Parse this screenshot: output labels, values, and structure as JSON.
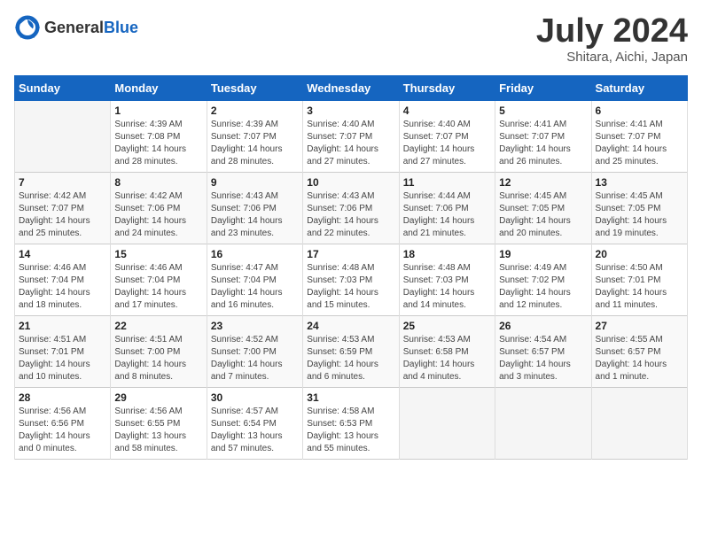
{
  "header": {
    "logo_general": "General",
    "logo_blue": "Blue",
    "month": "July 2024",
    "location": "Shitara, Aichi, Japan"
  },
  "days_of_week": [
    "Sunday",
    "Monday",
    "Tuesday",
    "Wednesday",
    "Thursday",
    "Friday",
    "Saturday"
  ],
  "weeks": [
    [
      {
        "day": "",
        "info": ""
      },
      {
        "day": "1",
        "info": "Sunrise: 4:39 AM\nSunset: 7:08 PM\nDaylight: 14 hours\nand 28 minutes."
      },
      {
        "day": "2",
        "info": "Sunrise: 4:39 AM\nSunset: 7:07 PM\nDaylight: 14 hours\nand 28 minutes."
      },
      {
        "day": "3",
        "info": "Sunrise: 4:40 AM\nSunset: 7:07 PM\nDaylight: 14 hours\nand 27 minutes."
      },
      {
        "day": "4",
        "info": "Sunrise: 4:40 AM\nSunset: 7:07 PM\nDaylight: 14 hours\nand 27 minutes."
      },
      {
        "day": "5",
        "info": "Sunrise: 4:41 AM\nSunset: 7:07 PM\nDaylight: 14 hours\nand 26 minutes."
      },
      {
        "day": "6",
        "info": "Sunrise: 4:41 AM\nSunset: 7:07 PM\nDaylight: 14 hours\nand 25 minutes."
      }
    ],
    [
      {
        "day": "7",
        "info": "Sunrise: 4:42 AM\nSunset: 7:07 PM\nDaylight: 14 hours\nand 25 minutes."
      },
      {
        "day": "8",
        "info": "Sunrise: 4:42 AM\nSunset: 7:06 PM\nDaylight: 14 hours\nand 24 minutes."
      },
      {
        "day": "9",
        "info": "Sunrise: 4:43 AM\nSunset: 7:06 PM\nDaylight: 14 hours\nand 23 minutes."
      },
      {
        "day": "10",
        "info": "Sunrise: 4:43 AM\nSunset: 7:06 PM\nDaylight: 14 hours\nand 22 minutes."
      },
      {
        "day": "11",
        "info": "Sunrise: 4:44 AM\nSunset: 7:06 PM\nDaylight: 14 hours\nand 21 minutes."
      },
      {
        "day": "12",
        "info": "Sunrise: 4:45 AM\nSunset: 7:05 PM\nDaylight: 14 hours\nand 20 minutes."
      },
      {
        "day": "13",
        "info": "Sunrise: 4:45 AM\nSunset: 7:05 PM\nDaylight: 14 hours\nand 19 minutes."
      }
    ],
    [
      {
        "day": "14",
        "info": "Sunrise: 4:46 AM\nSunset: 7:04 PM\nDaylight: 14 hours\nand 18 minutes."
      },
      {
        "day": "15",
        "info": "Sunrise: 4:46 AM\nSunset: 7:04 PM\nDaylight: 14 hours\nand 17 minutes."
      },
      {
        "day": "16",
        "info": "Sunrise: 4:47 AM\nSunset: 7:04 PM\nDaylight: 14 hours\nand 16 minutes."
      },
      {
        "day": "17",
        "info": "Sunrise: 4:48 AM\nSunset: 7:03 PM\nDaylight: 14 hours\nand 15 minutes."
      },
      {
        "day": "18",
        "info": "Sunrise: 4:48 AM\nSunset: 7:03 PM\nDaylight: 14 hours\nand 14 minutes."
      },
      {
        "day": "19",
        "info": "Sunrise: 4:49 AM\nSunset: 7:02 PM\nDaylight: 14 hours\nand 12 minutes."
      },
      {
        "day": "20",
        "info": "Sunrise: 4:50 AM\nSunset: 7:01 PM\nDaylight: 14 hours\nand 11 minutes."
      }
    ],
    [
      {
        "day": "21",
        "info": "Sunrise: 4:51 AM\nSunset: 7:01 PM\nDaylight: 14 hours\nand 10 minutes."
      },
      {
        "day": "22",
        "info": "Sunrise: 4:51 AM\nSunset: 7:00 PM\nDaylight: 14 hours\nand 8 minutes."
      },
      {
        "day": "23",
        "info": "Sunrise: 4:52 AM\nSunset: 7:00 PM\nDaylight: 14 hours\nand 7 minutes."
      },
      {
        "day": "24",
        "info": "Sunrise: 4:53 AM\nSunset: 6:59 PM\nDaylight: 14 hours\nand 6 minutes."
      },
      {
        "day": "25",
        "info": "Sunrise: 4:53 AM\nSunset: 6:58 PM\nDaylight: 14 hours\nand 4 minutes."
      },
      {
        "day": "26",
        "info": "Sunrise: 4:54 AM\nSunset: 6:57 PM\nDaylight: 14 hours\nand 3 minutes."
      },
      {
        "day": "27",
        "info": "Sunrise: 4:55 AM\nSunset: 6:57 PM\nDaylight: 14 hours\nand 1 minute."
      }
    ],
    [
      {
        "day": "28",
        "info": "Sunrise: 4:56 AM\nSunset: 6:56 PM\nDaylight: 14 hours\nand 0 minutes."
      },
      {
        "day": "29",
        "info": "Sunrise: 4:56 AM\nSunset: 6:55 PM\nDaylight: 13 hours\nand 58 minutes."
      },
      {
        "day": "30",
        "info": "Sunrise: 4:57 AM\nSunset: 6:54 PM\nDaylight: 13 hours\nand 57 minutes."
      },
      {
        "day": "31",
        "info": "Sunrise: 4:58 AM\nSunset: 6:53 PM\nDaylight: 13 hours\nand 55 minutes."
      },
      {
        "day": "",
        "info": ""
      },
      {
        "day": "",
        "info": ""
      },
      {
        "day": "",
        "info": ""
      }
    ]
  ]
}
